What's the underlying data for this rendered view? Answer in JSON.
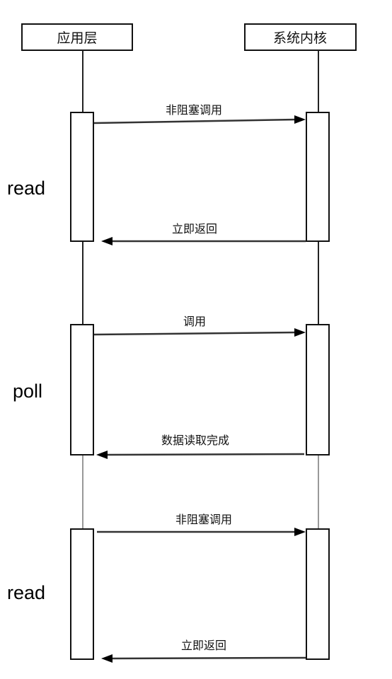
{
  "participants": {
    "app": "应用层",
    "kernel": "系统内核"
  },
  "phases": [
    {
      "label": "read"
    },
    {
      "label": "poll"
    },
    {
      "label": "read"
    }
  ],
  "messages": [
    {
      "text": "非阻塞调用",
      "direction": "app-to-kernel"
    },
    {
      "text": "立即返回",
      "direction": "kernel-to-app"
    },
    {
      "text": "调用",
      "direction": "app-to-kernel"
    },
    {
      "text": "数据读取完成",
      "direction": "kernel-to-app"
    },
    {
      "text": "非阻塞调用",
      "direction": "app-to-kernel"
    },
    {
      "text": "立即返回",
      "direction": "kernel-to-app"
    }
  ]
}
